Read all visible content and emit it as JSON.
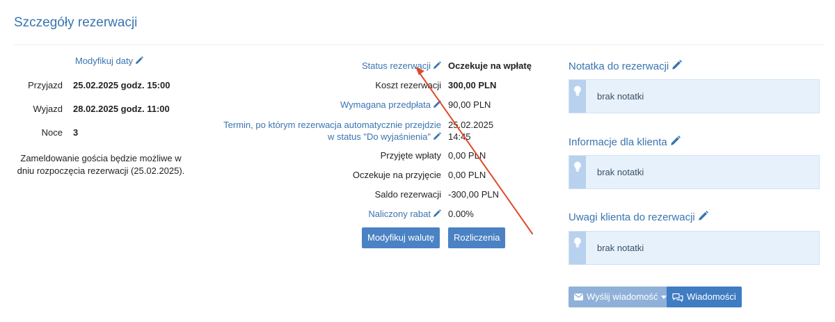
{
  "header": {
    "title": "Szczegóły rezerwacji"
  },
  "dates": {
    "modify_link": "Modyfikuj daty",
    "arrival_label": "Przyjazd",
    "arrival_value": "25.02.2025 godz. 15:00",
    "departure_label": "Wyjazd",
    "departure_value": "28.02.2025 godz. 11:00",
    "nights_label": "Noce",
    "nights_value": "3",
    "checkin_note": "Zameldowanie gościa będzie możliwe w dniu rozpoczęcia rezerwacji (25.02.2025)."
  },
  "booking": {
    "status_label": "Status rezerwacji",
    "status_value": "Oczekuje na wpłatę",
    "cost_label": "Koszt rezerwacji",
    "cost_value": "300,00 PLN",
    "deposit_label": "Wymagana przedpłata",
    "deposit_value": "90,00 PLN",
    "deadline_label_line1": "Termin, po którym rezerwacja automatycznie przejdzie",
    "deadline_label_line2": "w status \"Do wyjaśnienia\"",
    "deadline_value_line1": "25.02.2025",
    "deadline_value_line2": "14:45",
    "paid_label": "Przyjęte wpłaty",
    "paid_value": "0,00 PLN",
    "pending_label": "Oczekuje na przyjęcie",
    "pending_value": "0,00 PLN",
    "balance_label": "Saldo rezerwacji",
    "balance_value": "-300,00 PLN",
    "discount_label": "Naliczony rabat",
    "discount_value": "0.00%",
    "modify_currency_button": "Modyfikuj walutę",
    "settlements_button": "Rozliczenia"
  },
  "notes": {
    "booking_note_title": "Notatka do rezerwacji",
    "booking_note_text": "brak notatki",
    "client_info_title": "Informacje dla klienta",
    "client_info_text": "brak notatki",
    "client_remarks_title": "Uwagi klienta do rezerwacji",
    "client_remarks_text": "brak notatki"
  },
  "actions": {
    "send_message_button": "Wyślij wiadomość",
    "messages_button": "Wiadomości"
  },
  "colors": {
    "link": "#3a74b0",
    "button": "#4a82c4",
    "note_bg": "#e7f1fb",
    "annotation_arrow": "#e0482a"
  }
}
